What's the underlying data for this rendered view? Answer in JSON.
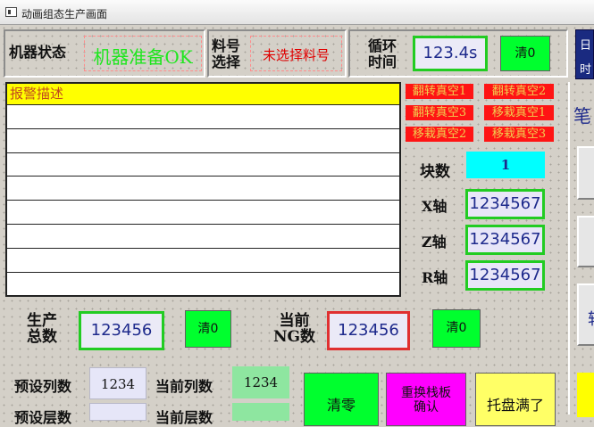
{
  "window": {
    "title": "动画组态生产画面"
  },
  "status": {
    "label": "机器状态",
    "value": "机器准备OK"
  },
  "material": {
    "label_line1": "料号",
    "label_line2": "选择",
    "value": "未选择料号"
  },
  "cycle": {
    "label_line1": "循环",
    "label_line2": "时间",
    "value": "123.4s",
    "clear_label": "清0"
  },
  "alarm_table": {
    "header": "报警描述",
    "rows": [
      "",
      "",
      "",
      "",
      "",
      "",
      "",
      ""
    ]
  },
  "alarms": [
    "翻转真空1",
    "翻转真空2",
    "翻转真空3",
    "移栽真空1",
    "移栽真空2",
    "移栽真空3"
  ],
  "block_count": {
    "label": "块数",
    "value": "1"
  },
  "axes": [
    {
      "label": "X轴",
      "value": "1234567"
    },
    {
      "label": "Z轴",
      "value": "1234567"
    },
    {
      "label": "R轴",
      "value": "1234567"
    }
  ],
  "production_total": {
    "label_line1": "生产",
    "label_line2": "总数",
    "value": "123456",
    "clear_label": "清0"
  },
  "ng_count": {
    "label_line1": "当前",
    "label_line2": "NG数",
    "value": "123456",
    "clear_label": "清0"
  },
  "preset_columns": {
    "label": "预设列数",
    "value": "1234"
  },
  "current_columns": {
    "label": "当前列数",
    "value": "1234"
  },
  "preset_layers": {
    "label": "预设层数"
  },
  "current_layers": {
    "label": "当前层数"
  },
  "buttons": {
    "reset": "清零",
    "replace_pallet_line1": "重换栈板",
    "replace_pallet_line2": "确认",
    "tray_full": "托盘满了"
  },
  "right_panel": {
    "top_label_1": "日",
    "top_label_2": "时",
    "side_text_1": "笔",
    "side_text_2": "转"
  },
  "colors": {
    "ok_green": "#00e020",
    "alarm_red": "#ff1414",
    "text_blue": "#1e2a8c",
    "cyan": "#00ffff",
    "yellow": "#ffff00",
    "magenta": "#ff00ff"
  }
}
